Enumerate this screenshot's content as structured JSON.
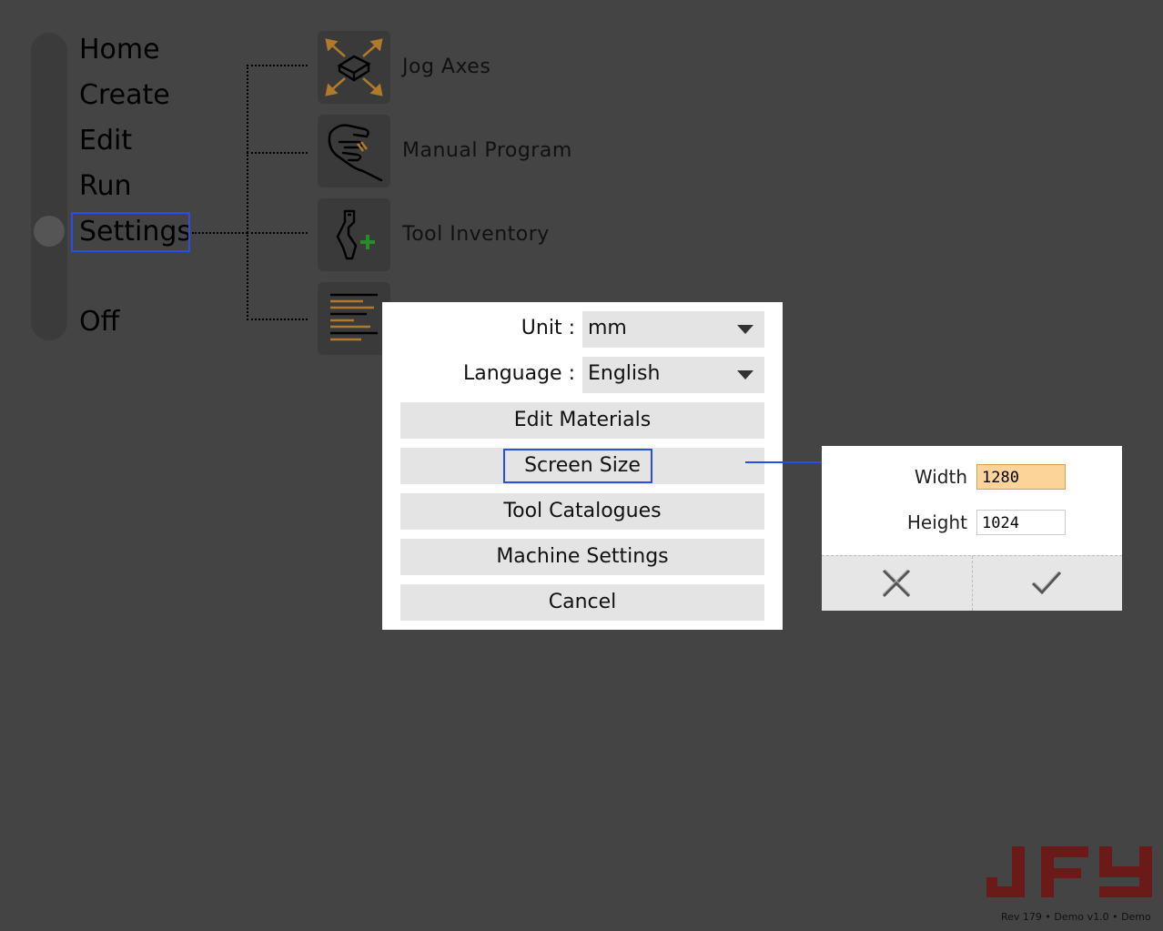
{
  "nav": {
    "items": [
      "Home",
      "Create",
      "Edit",
      "Run",
      "Settings",
      "Off"
    ],
    "selected": "Settings"
  },
  "submenu": {
    "items": [
      {
        "label": "Jog Axes",
        "icon": "jog-axes-icon"
      },
      {
        "label": "Manual Program",
        "icon": "manual-program-icon"
      },
      {
        "label": "Tool Inventory",
        "icon": "tool-inventory-icon"
      },
      {
        "label": "",
        "icon": "text-align-icon"
      }
    ]
  },
  "settings_dialog": {
    "unit_label": "Unit :",
    "unit_value": "mm",
    "language_label": "Language :",
    "language_value": "English",
    "buttons": [
      "Edit Materials",
      "Screen Size",
      "Tool Catalogues",
      "Machine Settings",
      "Cancel"
    ],
    "highlighted": "Screen Size"
  },
  "screen_size_popup": {
    "width_label": "Width",
    "width_value": "1280",
    "height_label": "Height",
    "height_value": "1024",
    "cancel_icon": "close-x-icon",
    "confirm_icon": "checkmark-icon"
  },
  "branding": {
    "logo": "JFY",
    "revision": "Rev 179 • Demo v1.0 • Demo"
  },
  "colors": {
    "background": "#444444",
    "highlight": "#2a4fe0",
    "logo": "#6b1a1a",
    "width_input_bg": "#fcd49a"
  }
}
